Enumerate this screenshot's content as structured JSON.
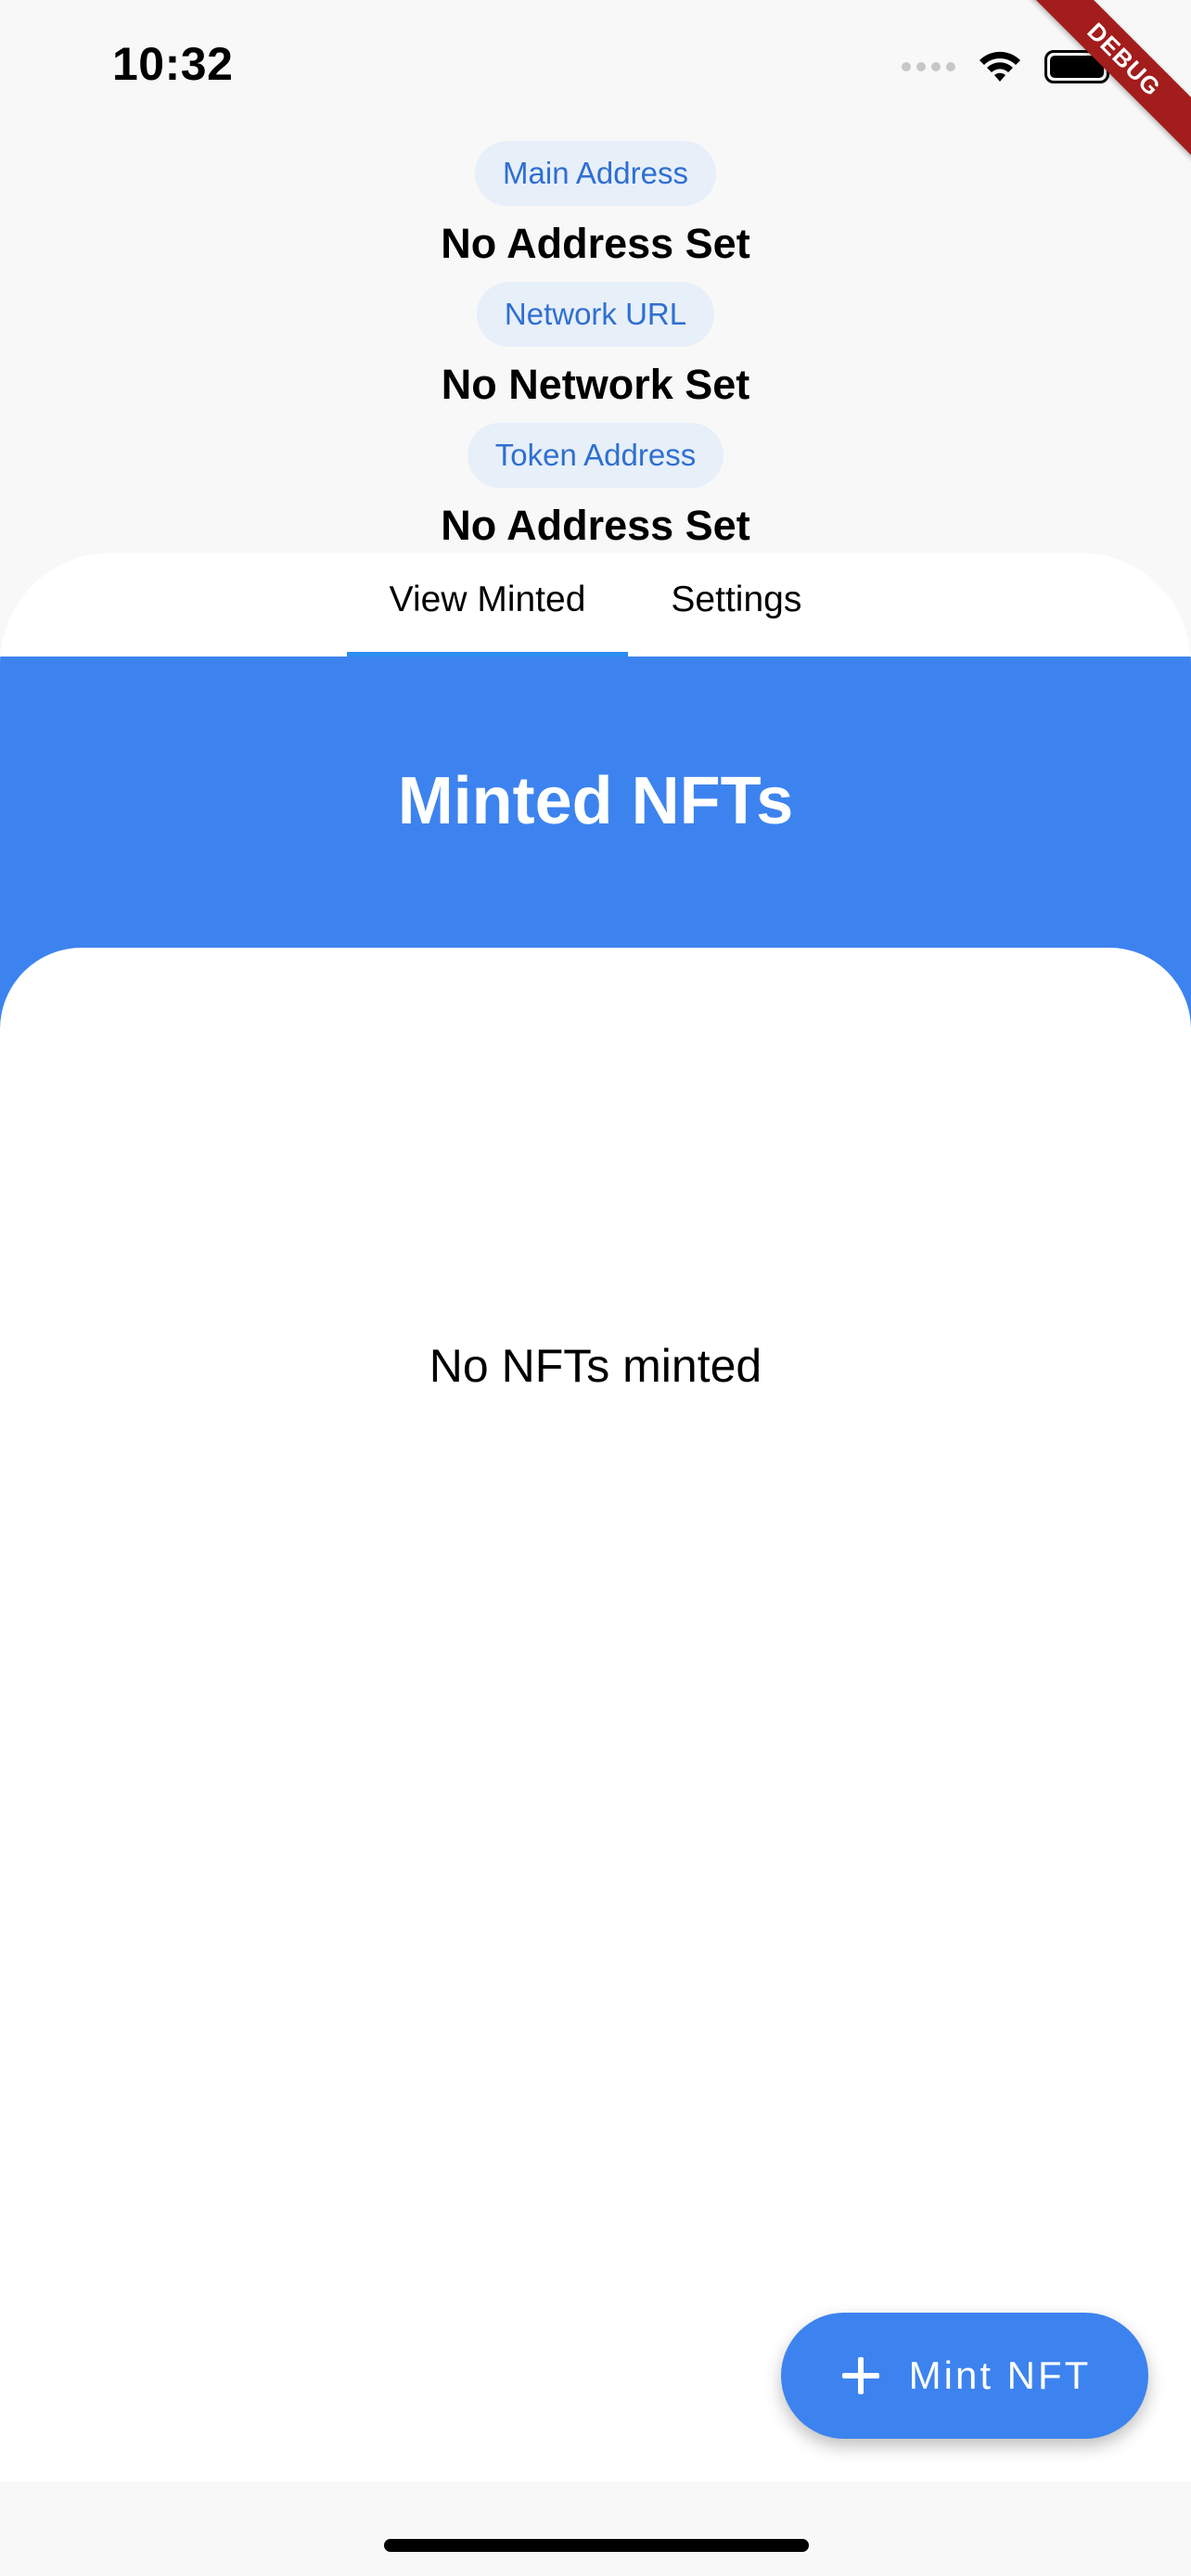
{
  "status_bar": {
    "time": "10:32"
  },
  "debug_banner": "DEBUG",
  "info": {
    "main_address_label": "Main Address",
    "main_address_value": "No Address Set",
    "network_url_label": "Network URL",
    "network_url_value": "No Network Set",
    "token_address_label": "Token Address",
    "token_address_value": "No Address Set"
  },
  "tabs": [
    {
      "label": "View Minted",
      "active": true
    },
    {
      "label": "Settings",
      "active": false
    }
  ],
  "main": {
    "title": "Minted NFTs",
    "empty_message": "No NFTs minted"
  },
  "fab": {
    "label": "Mint NFT",
    "icon": "plus-icon"
  },
  "colors": {
    "accent": "#3d83ef",
    "tab_indicator": "#2b8ef1",
    "chip_bg": "#e7eff9",
    "chip_text": "#2f6fd1",
    "debug": "#a31d1d"
  }
}
